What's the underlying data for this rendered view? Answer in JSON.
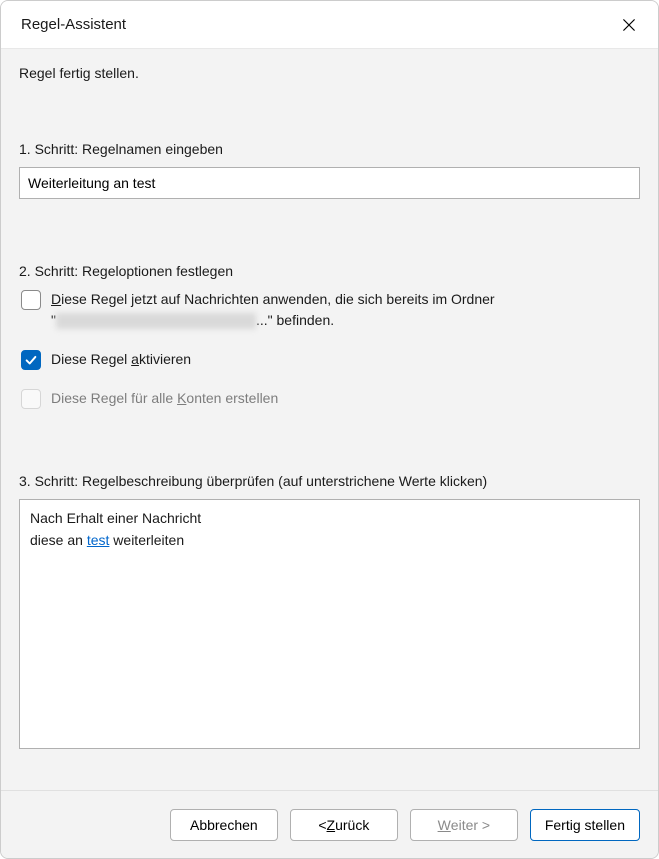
{
  "title": "Regel-Assistent",
  "subtitle": "Regel fertig stellen.",
  "step1": {
    "label_pre": "1. Schritt: Regel",
    "label_u": "n",
    "label_post": "amen eingeben",
    "value": "Weiterleitung an test"
  },
  "step2": {
    "label": "2. Schritt: Regeloptionen festlegen",
    "opt1_pre": "Diese Regel jetzt auf Nachrichten anwenden, die sich bereits im Ordner",
    "opt1_u": "D",
    "opt1_line2_prefix": "\"",
    "opt1_line2_suffix": "...\" befinden.",
    "opt2_pre": "Diese Regel ",
    "opt2_u": "a",
    "opt2_post": "ktivieren",
    "opt3_pre": "Diese Regel für alle ",
    "opt3_u": "K",
    "opt3_post": "onten erstellen"
  },
  "step3": {
    "label": "3. Schritt: Regelbeschreibung überprüfen (auf unterstrichene Werte klicken)",
    "line1": "Nach Erhalt einer Nachricht",
    "line2_pre": "diese an ",
    "line2_link": "test",
    "line2_post": " weiterleiten"
  },
  "buttons": {
    "cancel": "Abbrechen",
    "back_pre": "< ",
    "back_u": "Z",
    "back_post": "urück",
    "next_u": "W",
    "next_post": "eiter >",
    "finish": "Fertig stellen"
  }
}
